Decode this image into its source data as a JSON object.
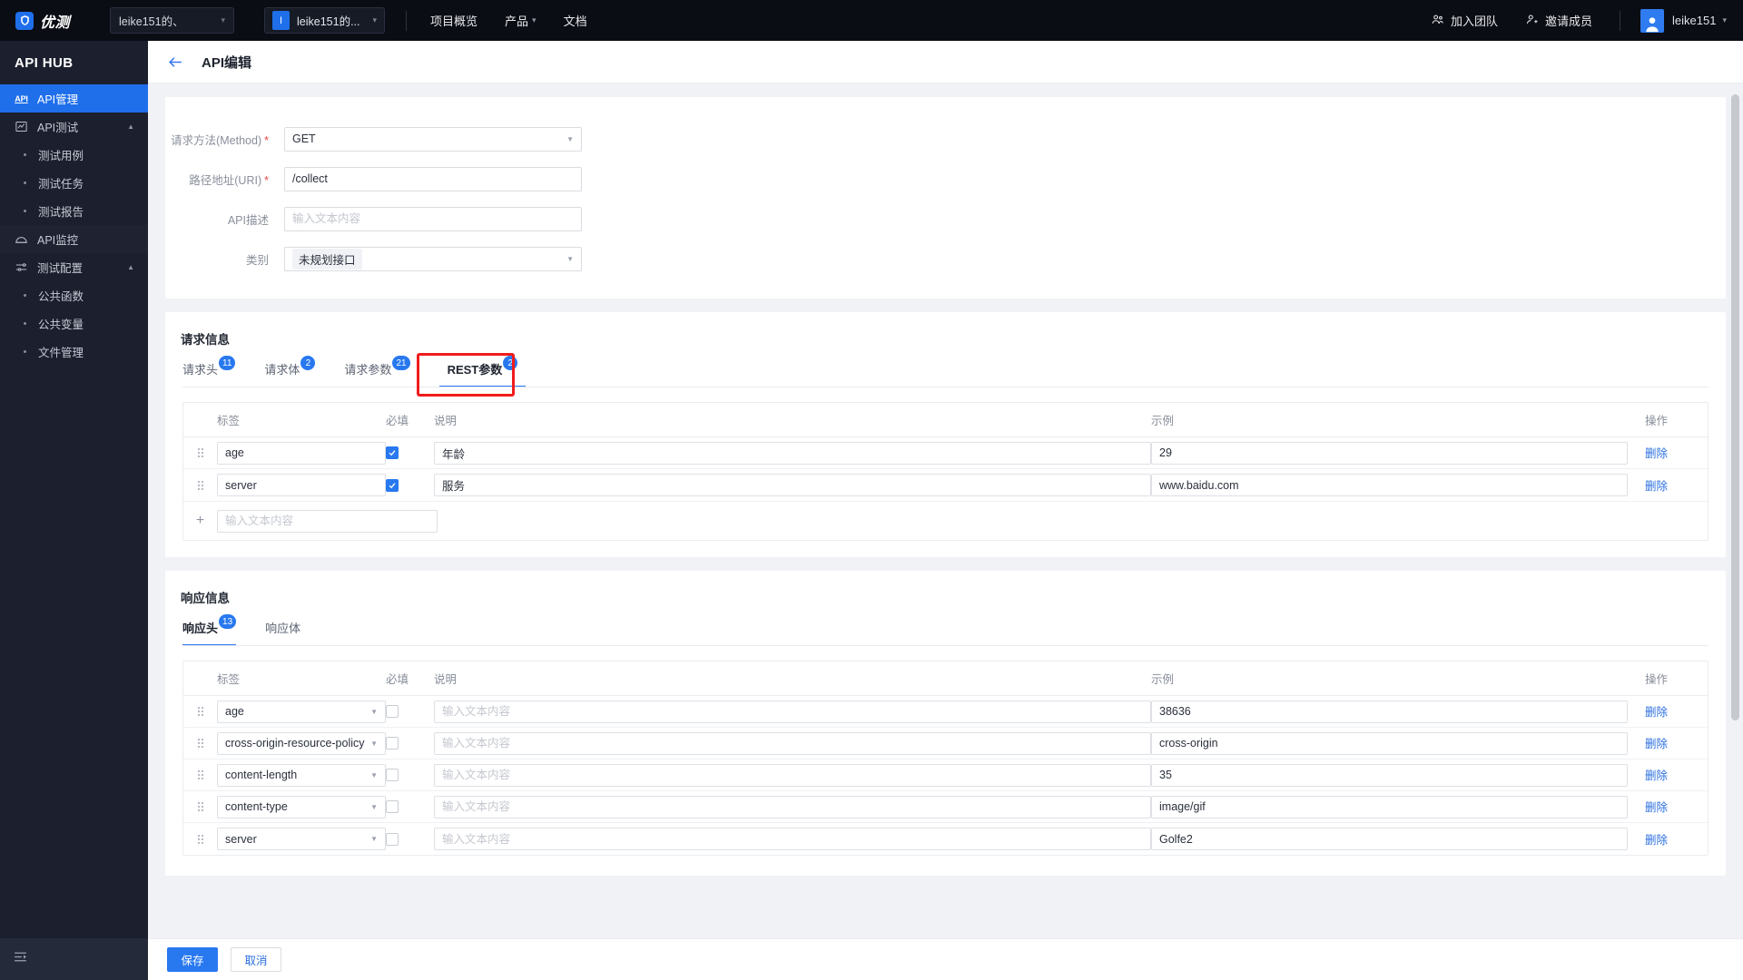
{
  "topbar": {
    "brand_name": "优测",
    "brand_icon": "shield-icon",
    "project_select": "leike151的、",
    "project_tab_initial": "I",
    "project_tab_label": "leike151的...",
    "nav": [
      {
        "label": "项目概览",
        "caret": false
      },
      {
        "label": "产品",
        "caret": true
      },
      {
        "label": "文档",
        "caret": false
      }
    ],
    "join_team": "加入团队",
    "invite_member": "邀请成员",
    "user_name": "leike151"
  },
  "sidebar": {
    "title": "API HUB",
    "items": [
      {
        "label": "API管理",
        "icon": "api-icon",
        "active": true,
        "type": "item"
      },
      {
        "label": "API测试",
        "icon": "chart-icon",
        "active": false,
        "type": "item",
        "caret": "up"
      },
      {
        "label": "测试用例",
        "type": "sub"
      },
      {
        "label": "测试任务",
        "type": "sub"
      },
      {
        "label": "测试报告",
        "type": "sub"
      },
      {
        "label": "API监控",
        "icon": "monitor-icon",
        "active": false,
        "type": "item",
        "shaded": true
      },
      {
        "label": "测试配置",
        "icon": "sliders-icon",
        "active": false,
        "type": "item",
        "caret": "up"
      },
      {
        "label": "公共函数",
        "type": "sub"
      },
      {
        "label": "公共变量",
        "type": "sub"
      },
      {
        "label": "文件管理",
        "type": "sub"
      }
    ],
    "collapse_icon": "collapse-menu-icon"
  },
  "page": {
    "back_icon": "back-arrow-icon",
    "title": "API编辑"
  },
  "form": {
    "rows": [
      {
        "label": "请求方法(Method)",
        "required": true,
        "type": "select",
        "value": "GET"
      },
      {
        "label": "路径地址(URI)",
        "required": true,
        "type": "input",
        "value": "/collect"
      },
      {
        "label": "API描述",
        "required": false,
        "type": "input",
        "value": "",
        "placeholder": "输入文本内容"
      },
      {
        "label": "类别",
        "required": false,
        "type": "select-tag",
        "value": "未规划接口"
      }
    ]
  },
  "request_section": {
    "title": "请求信息",
    "tabs": [
      {
        "label": "请求头",
        "badge": "11",
        "active": false
      },
      {
        "label": "请求体",
        "badge": "2",
        "active": false
      },
      {
        "label": "请求参数",
        "badge": "21",
        "active": false
      },
      {
        "label": "REST参数",
        "badge": "2",
        "active": true,
        "highlighted": true
      }
    ],
    "columns": [
      "标签",
      "必填",
      "说明",
      "示例",
      "操作"
    ],
    "rows": [
      {
        "label": "age",
        "required": true,
        "desc": "年龄",
        "example": "29",
        "action": "删除"
      },
      {
        "label": "server",
        "required": true,
        "desc": "服务",
        "example": "www.baidu.com",
        "action": "删除"
      }
    ],
    "add_placeholder": "输入文本内容",
    "add_icon": "plus-icon"
  },
  "response_section": {
    "title": "响应信息",
    "tabs": [
      {
        "label": "响应头",
        "badge": "13",
        "active": true
      },
      {
        "label": "响应体",
        "badge": "",
        "active": false
      }
    ],
    "columns": [
      "标签",
      "必填",
      "说明",
      "示例",
      "操作"
    ],
    "desc_placeholder": "输入文本内容",
    "rows": [
      {
        "label": "age",
        "required": false,
        "desc": "",
        "example": "38636",
        "action": "删除"
      },
      {
        "label": "cross-origin-resource-policy",
        "required": false,
        "desc": "",
        "example": "cross-origin",
        "action": "删除"
      },
      {
        "label": "content-length",
        "required": false,
        "desc": "",
        "example": "35",
        "action": "删除"
      },
      {
        "label": "content-type",
        "required": false,
        "desc": "",
        "example": "image/gif",
        "action": "删除"
      },
      {
        "label": "server",
        "required": false,
        "desc": "",
        "example": "Golfe2",
        "action": "删除"
      }
    ]
  },
  "actions": {
    "save": "保存",
    "cancel": "取消"
  },
  "colors": {
    "accent": "#2878f0",
    "sidebar_bg": "#1b1f2e",
    "topbar_bg": "#0b0d14",
    "highlight_red": "#f01c1c",
    "required_red": "#e64545"
  }
}
